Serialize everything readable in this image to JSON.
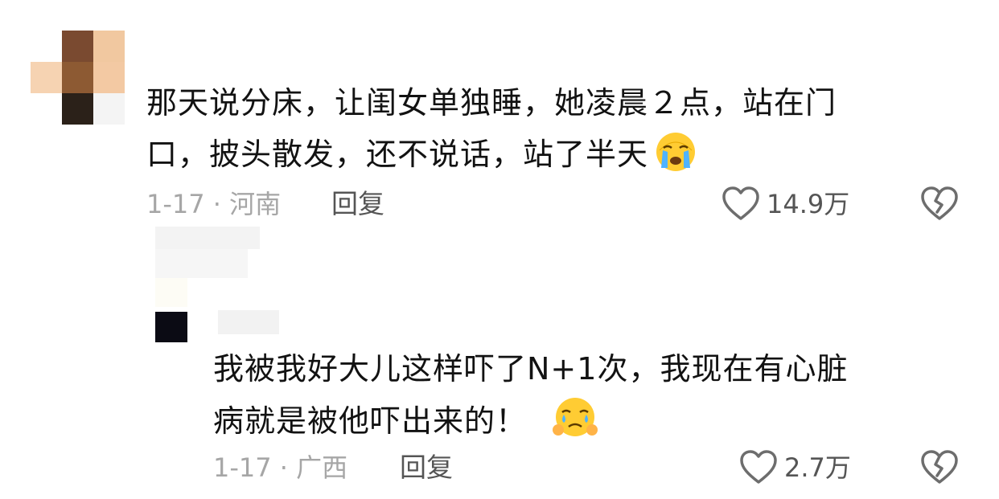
{
  "comment": {
    "lines": [
      "那天说分床，让闺女单独睡，她凌晨２点，站在门",
      "口，披头散发，还不说话，站了半天"
    ],
    "emoji": "loudly-crying-face-emoji",
    "date_location": "1-17 · 河南",
    "reply_label": "回复",
    "like_count": "14.9万"
  },
  "reply": {
    "lines": [
      "我被我好大儿这样吓了N+1次，我现在有心脏",
      "病就是被他吓出来的！"
    ],
    "emoji": "face-holding-back-tears-emoji",
    "date_location": "1-17 · 广西",
    "reply_label": "回复",
    "like_count": "2.7万"
  },
  "colors": {
    "text": "#121212",
    "meta": "#a6a6a6",
    "action": "#555555"
  },
  "icons": [
    "heart-outline-icon",
    "broken-heart-icon"
  ]
}
